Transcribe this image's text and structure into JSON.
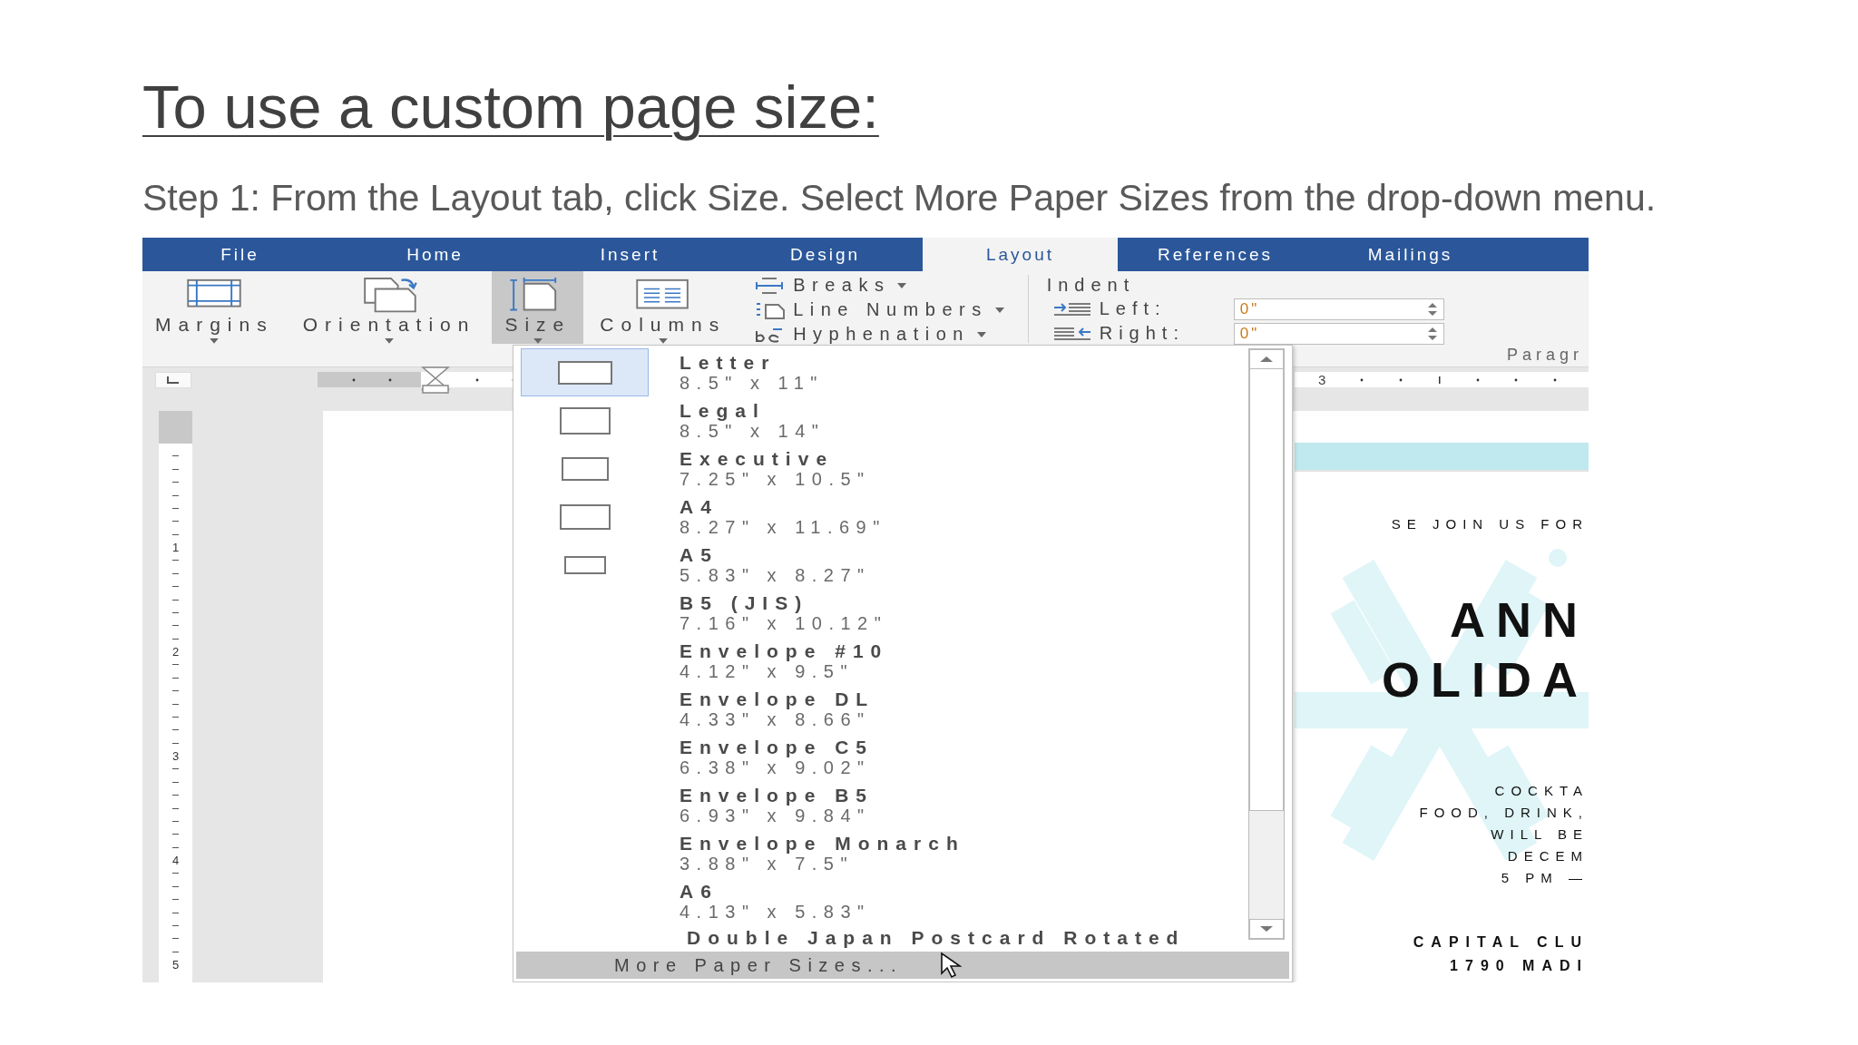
{
  "slide": {
    "title": "To use a custom page size:",
    "instruction": "Step 1: From the Layout tab, click Size. Select More Paper Sizes from the drop-down menu."
  },
  "word": {
    "tabs": [
      {
        "label": "File",
        "selected": false
      },
      {
        "label": "Home",
        "selected": false
      },
      {
        "label": "Insert",
        "selected": false
      },
      {
        "label": "Design",
        "selected": false
      },
      {
        "label": "Layout",
        "selected": true
      },
      {
        "label": "References",
        "selected": false
      },
      {
        "label": "Mailings",
        "selected": false
      }
    ],
    "ribbon": {
      "large_buttons": [
        {
          "label": "Margins",
          "selected": false
        },
        {
          "label": "Orientation",
          "selected": false
        },
        {
          "label": "Size",
          "selected": true
        },
        {
          "label": "Columns",
          "selected": false
        }
      ],
      "small_buttons": [
        {
          "label": "Breaks"
        },
        {
          "label": "Line Numbers"
        },
        {
          "label": "Hyphenation"
        }
      ],
      "indent": {
        "title": "Indent",
        "fields": [
          {
            "label": "Left:",
            "value": "0\""
          },
          {
            "label": "Right:",
            "value": "0\""
          }
        ]
      },
      "group_label": "Paragr"
    },
    "rulers": {
      "horizontal": [
        "3"
      ],
      "vertical": [
        "1",
        "2",
        "3",
        "4",
        "5"
      ]
    },
    "size_menu": {
      "items": [
        {
          "name": "Letter",
          "dimensions": "8.5\" x 11\"",
          "selected": true,
          "icon": true
        },
        {
          "name": "Legal",
          "dimensions": "8.5\" x 14\"",
          "selected": false,
          "icon": true
        },
        {
          "name": "Executive",
          "dimensions": "7.25\" x 10.5\"",
          "selected": false,
          "icon": true
        },
        {
          "name": "A4",
          "dimensions": "8.27\" x 11.69\"",
          "selected": false,
          "icon": true
        },
        {
          "name": "A5",
          "dimensions": "5.83\" x 8.27\"",
          "selected": false,
          "icon": true
        },
        {
          "name": "B5 (JIS)",
          "dimensions": "7.16\" x 10.12\"",
          "selected": false,
          "icon": false
        },
        {
          "name": "Envelope #10",
          "dimensions": "4.12\" x 9.5\"",
          "selected": false,
          "icon": false
        },
        {
          "name": "Envelope DL",
          "dimensions": "4.33\" x 8.66\"",
          "selected": false,
          "icon": false
        },
        {
          "name": "Envelope C5",
          "dimensions": "6.38\" x 9.02\"",
          "selected": false,
          "icon": false
        },
        {
          "name": "Envelope B5",
          "dimensions": "6.93\" x 9.84\"",
          "selected": false,
          "icon": false
        },
        {
          "name": "Envelope Monarch",
          "dimensions": "3.88\" x 7.5\"",
          "selected": false,
          "icon": false
        },
        {
          "name": "A6",
          "dimensions": "4.13\" x 5.83\"",
          "selected": false,
          "icon": false
        }
      ],
      "partial_item": "Double Japan Postcard Rotated",
      "footer": "More Paper Sizes..."
    },
    "document": {
      "lines": [
        {
          "text": "SE JOIN US FOR",
          "kind": "small"
        },
        {
          "text": "ANN",
          "kind": "heading"
        },
        {
          "text": "OLIDA",
          "kind": "heading"
        },
        {
          "text": "COCKTA",
          "kind": "small"
        },
        {
          "text": "FOOD, DRINK,",
          "kind": "small"
        },
        {
          "text": "WILL BE",
          "kind": "small"
        },
        {
          "text": "DECEM",
          "kind": "small"
        },
        {
          "text": "5 PM —",
          "kind": "small"
        },
        {
          "text": "CAPITAL CLU",
          "kind": "bold"
        },
        {
          "text": "1790 MADI",
          "kind": "bold"
        }
      ]
    }
  }
}
